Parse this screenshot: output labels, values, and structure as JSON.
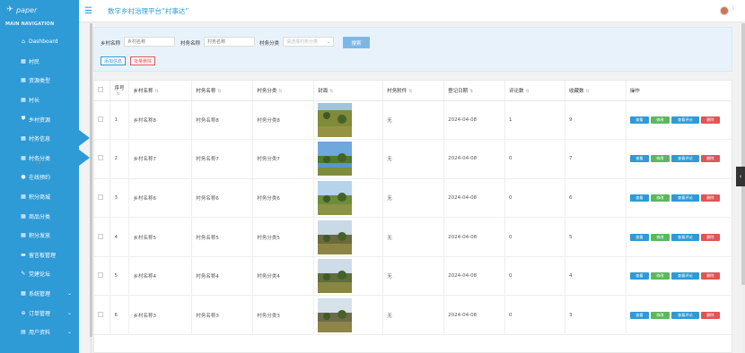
{
  "brand": {
    "logo_text": "paper"
  },
  "header": {
    "title": "数字乡村治理平台“村事达”"
  },
  "sidebar": {
    "section_title": "MAIN NAVIGATION",
    "items": [
      {
        "label": "Dashboard",
        "icon": "home-icon",
        "chevron": ""
      },
      {
        "label": "村民",
        "icon": "grid-icon",
        "chevron": ""
      },
      {
        "label": "资源类型",
        "icon": "grid-icon",
        "chevron": ""
      },
      {
        "label": "村长",
        "icon": "grid-icon",
        "chevron": ""
      },
      {
        "label": "乡村资源",
        "icon": "shield-icon",
        "chevron": ""
      },
      {
        "label": "村务信息",
        "icon": "grid-icon",
        "chevron": ""
      },
      {
        "label": "村务分类",
        "icon": "grid-icon",
        "chevron": ""
      },
      {
        "label": "在线预约",
        "icon": "user-icon",
        "chevron": ""
      },
      {
        "label": "积分商城",
        "icon": "grid-icon",
        "chevron": ""
      },
      {
        "label": "商品分类",
        "icon": "grid-icon",
        "chevron": ""
      },
      {
        "label": "积分发放",
        "icon": "grid-icon",
        "chevron": ""
      },
      {
        "label": "留言板管理",
        "icon": "chat-icon",
        "chevron": ""
      },
      {
        "label": "党建论坛",
        "icon": "edit-icon",
        "chevron": ""
      },
      {
        "label": "系统管理",
        "icon": "grid-icon",
        "chevron": "⌄"
      },
      {
        "label": "订单管理",
        "icon": "cart-icon",
        "chevron": "⌄"
      },
      {
        "label": "用户资料",
        "icon": "doc-icon",
        "chevron": "⌄"
      }
    ]
  },
  "search": {
    "village_label": "乡村名称",
    "village_placeholder": "乡村名称",
    "affair_label": "村务名称",
    "affair_placeholder": "村务名称",
    "category_label": "村务分类",
    "category_placeholder": "请选择村务分类",
    "search_button": "搜索",
    "add_button": "添加信息",
    "bulk_delete_button": "批量删除"
  },
  "table": {
    "columns": [
      "序号",
      "乡村名称",
      "村务名称",
      "村务分类",
      "封面",
      "村务附件",
      "登记日期",
      "评论数",
      "收藏数",
      "操作"
    ],
    "actions": {
      "view": "查看",
      "edit": "修改",
      "reviews": "查看评论",
      "delete": "删除"
    },
    "rows": [
      {
        "no": "1",
        "village": "乡村名称8",
        "name": "村务名称8",
        "category": "村务分类8",
        "attachment": "无",
        "date": "2024-04-08",
        "comments": "1",
        "favorites": "9",
        "cover": "cover-8"
      },
      {
        "no": "2",
        "village": "乡村名称7",
        "name": "村务名称7",
        "category": "村务分类7",
        "attachment": "无",
        "date": "2024-04-08",
        "comments": "0",
        "favorites": "7",
        "cover": "cover-7"
      },
      {
        "no": "3",
        "village": "乡村名称6",
        "name": "村务名称6",
        "category": "村务分类6",
        "attachment": "无",
        "date": "2024-04-08",
        "comments": "0",
        "favorites": "6",
        "cover": "cover-6"
      },
      {
        "no": "4",
        "village": "乡村名称5",
        "name": "村务名称5",
        "category": "村务分类5",
        "attachment": "无",
        "date": "2024-04-08",
        "comments": "0",
        "favorites": "5",
        "cover": "cover-5"
      },
      {
        "no": "5",
        "village": "乡村名称4",
        "name": "村务名称4",
        "category": "村务分类4",
        "attachment": "无",
        "date": "2024-04-08",
        "comments": "0",
        "favorites": "4",
        "cover": "cover-4"
      },
      {
        "no": "6",
        "village": "乡村名称3",
        "name": "村务名称3",
        "category": "村务分类3",
        "attachment": "无",
        "date": "2024-04-08",
        "comments": "0",
        "favorites": "3",
        "cover": "cover-3"
      }
    ]
  },
  "colors": {
    "primary": "#2e9ad6",
    "success": "#5cb85c",
    "danger": "#e05555"
  }
}
